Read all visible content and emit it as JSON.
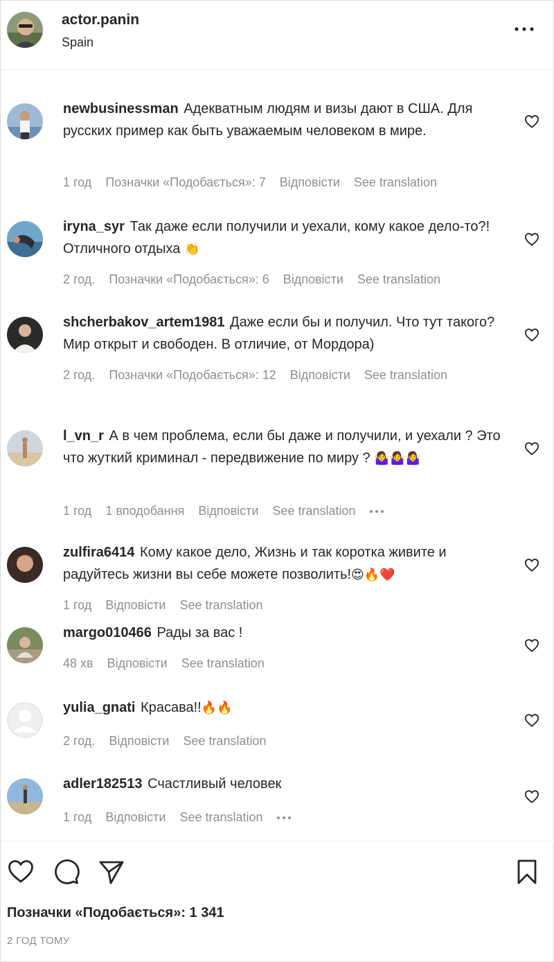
{
  "post_header": {
    "username": "actor.panin",
    "location": "Spain",
    "more_icon": "more-horizontal-icon"
  },
  "comments": [
    {
      "username": "newbusinessman",
      "text": "Адекватным людям и визы дают в США. Для русских пример как быть уважаемым человеком в мире.",
      "emoji": "",
      "time": "1 год",
      "likes": "Позначки «Подобається»: 7",
      "reply": "Відповісти",
      "translate": "See translation"
    },
    {
      "username": "iryna_syr",
      "text": "Так даже если получили и уехали, кому какое дело-то?! Отличного отдыха",
      "emoji": "👏",
      "time": "2 год.",
      "likes": "Позначки «Подобається»: 6",
      "reply": "Відповісти",
      "translate": "See translation"
    },
    {
      "username": "shcherbakov_artem1981",
      "text": "Даже если бы и получил. Что тут такого? Мир открыт и свободен. В отличие, от Мордора)",
      "emoji": "",
      "time": "2 год.",
      "likes": "Позначки «Подобається»: 12",
      "reply": "Відповісти",
      "translate": "See translation"
    },
    {
      "username": "l_vn_r",
      "text": "А в чем проблема, если бы даже и получили, и уехали ? Это что жуткий криминал - передвижение по миру ?",
      "emoji": "🤷‍♀️🤷‍♀️🤷‍♀️",
      "time": "1 год",
      "likes": "1 вподобання",
      "reply": "Відповісти",
      "translate": "See translation"
    },
    {
      "username": "zulfira6414",
      "text": "Кому какое дело, Жизнь и так коротка живите и радуйтесь жизни вы себе можете позволить!",
      "emoji": "😍🔥❤️",
      "time": "1 год",
      "likes": "",
      "reply": "Відповісти",
      "translate": "See translation"
    },
    {
      "username": "margo010466",
      "text": "Рады за вас !",
      "emoji": "",
      "time": "48 хв",
      "likes": "",
      "reply": "Відповісти",
      "translate": "See translation"
    },
    {
      "username": "yulia_gnati",
      "text": "Красава!!",
      "emoji": "🔥🔥",
      "time": "2 год.",
      "likes": "",
      "reply": "Відповісти",
      "translate": "See translation"
    },
    {
      "username": "adler182513",
      "text": "Счастливый человек",
      "emoji": "",
      "time": "1 год",
      "likes": "",
      "reply": "Відповісти",
      "translate": "See translation"
    }
  ],
  "footer": {
    "likes_total": "Позначки «Подобається»: 1 341",
    "post_age": "2 ГОД ТОМУ",
    "icons": [
      "heart-icon",
      "comment-icon",
      "share-icon",
      "bookmark-icon"
    ]
  },
  "colors": {
    "text": "#262626",
    "secondary": "#8e8e8e",
    "divider": "#efefef"
  }
}
